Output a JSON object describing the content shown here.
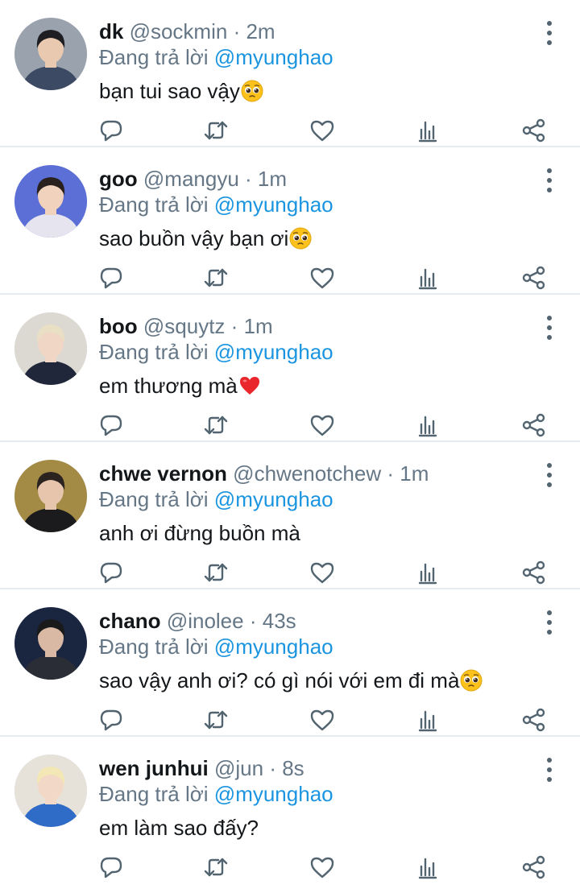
{
  "reply_prefix": "Đang trả lời",
  "colors": {
    "name": "#14171a",
    "secondary": "#657786",
    "mention": "#1b95e0",
    "divider": "#e6ecf0",
    "icon": "#536471"
  },
  "tweets": [
    {
      "name": "dk",
      "handle": "@sockmin",
      "time": "2m",
      "reply_to": "@myunghao",
      "text": "bạn tui sao vậy",
      "emoji": "pleading-face-emoji",
      "avatar_colors": {
        "bg": "#9aa3ad",
        "skin": "#e9c9b0",
        "hair": "#1d1d22",
        "shirt": "#3d4a63"
      }
    },
    {
      "name": "goo",
      "handle": "@mangyu",
      "time": "1m",
      "reply_to": "@myunghao",
      "text": "sao buồn vậy bạn ơi",
      "emoji": "pleading-face-emoji",
      "avatar_colors": {
        "bg": "#5b6fd6",
        "skin": "#f1d2bd",
        "hair": "#2a211e",
        "shirt": "#e6e4ee"
      }
    },
    {
      "name": "boo",
      "handle": "@squytz",
      "time": "1m",
      "reply_to": "@myunghao",
      "text": "em thương mà",
      "emoji": "red-heart-emoji",
      "avatar_colors": {
        "bg": "#dcd9d2",
        "skin": "#f0d6c4",
        "hair": "#e8dfc4",
        "shirt": "#20273a"
      }
    },
    {
      "name": "chwe vernon",
      "handle": "@chwenotchew",
      "time": "1m",
      "reply_to": "@myunghao",
      "text": "anh ơi đừng buồn mà",
      "emoji": "",
      "avatar_colors": {
        "bg": "#a38a45",
        "skin": "#e7c5ad",
        "hair": "#2b2320",
        "shirt": "#1b1b1d"
      }
    },
    {
      "name": "chano",
      "handle": "@inolee",
      "time": "43s",
      "reply_to": "@myunghao",
      "text": "sao vậy anh ơi? có gì nói với em đi mà",
      "emoji": "pleading-face-emoji",
      "avatar_colors": {
        "bg": "#1a2540",
        "skin": "#d9b8a4",
        "hair": "#1a1a1a",
        "shirt": "#2a2d36"
      }
    },
    {
      "name": "wen junhui",
      "handle": "@jun",
      "time": "8s",
      "reply_to": "@myunghao",
      "text": "em làm sao đấy?",
      "emoji": "",
      "avatar_colors": {
        "bg": "#e6e2da",
        "skin": "#f2d8c6",
        "hair": "#f3e7b5",
        "shirt": "#2f6cc8"
      }
    }
  ]
}
